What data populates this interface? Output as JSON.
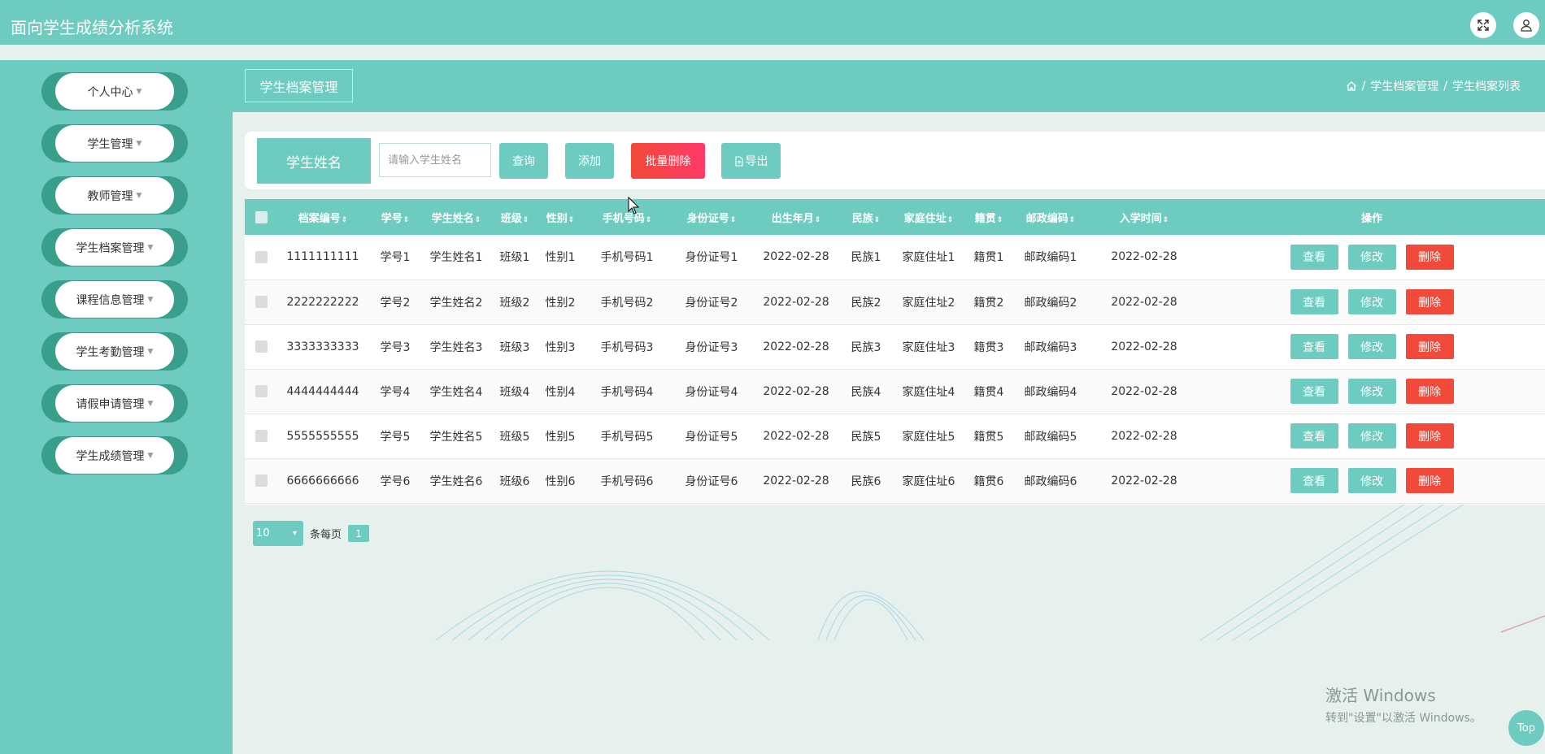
{
  "app": {
    "title": "面向学生成绩分析系统"
  },
  "header": {
    "fullscreen_icon": "expand-icon",
    "user_icon": "user-icon"
  },
  "sidebar": {
    "items": [
      {
        "label": "个人中心"
      },
      {
        "label": "学生管理"
      },
      {
        "label": "教师管理"
      },
      {
        "label": "学生档案管理"
      },
      {
        "label": "课程信息管理"
      },
      {
        "label": "学生考勤管理"
      },
      {
        "label": "请假申请管理"
      },
      {
        "label": "学生成绩管理"
      }
    ]
  },
  "page": {
    "tab_label": "学生档案管理",
    "breadcrumb": {
      "separator": "/",
      "level1": "学生档案管理",
      "level2": "学生档案列表"
    }
  },
  "search": {
    "label": "学生姓名",
    "placeholder": "请输入学生姓名",
    "value": "",
    "query_label": "查询",
    "add_label": "添加",
    "batch_delete_label": "批量删除",
    "export_label": "导出"
  },
  "table": {
    "columns": [
      "档案编号",
      "学号",
      "学生姓名",
      "班级",
      "性别",
      "手机号码",
      "身份证号",
      "出生年月",
      "民族",
      "家庭住址",
      "籍贯",
      "邮政编码",
      "入学时间",
      "操作"
    ],
    "rows": [
      [
        "1111111111",
        "学号1",
        "学生姓名1",
        "班级1",
        "性别1",
        "手机号码1",
        "身份证号1",
        "2022-02-28",
        "民族1",
        "家庭住址1",
        "籍贯1",
        "邮政编码1",
        "2022-02-28"
      ],
      [
        "2222222222",
        "学号2",
        "学生姓名2",
        "班级2",
        "性别2",
        "手机号码2",
        "身份证号2",
        "2022-02-28",
        "民族2",
        "家庭住址2",
        "籍贯2",
        "邮政编码2",
        "2022-02-28"
      ],
      [
        "3333333333",
        "学号3",
        "学生姓名3",
        "班级3",
        "性别3",
        "手机号码3",
        "身份证号3",
        "2022-02-28",
        "民族3",
        "家庭住址3",
        "籍贯3",
        "邮政编码3",
        "2022-02-28"
      ],
      [
        "4444444444",
        "学号4",
        "学生姓名4",
        "班级4",
        "性别4",
        "手机号码4",
        "身份证号4",
        "2022-02-28",
        "民族4",
        "家庭住址4",
        "籍贯4",
        "邮政编码4",
        "2022-02-28"
      ],
      [
        "5555555555",
        "学号5",
        "学生姓名5",
        "班级5",
        "性别5",
        "手机号码5",
        "身份证号5",
        "2022-02-28",
        "民族5",
        "家庭住址5",
        "籍贯5",
        "邮政编码5",
        "2022-02-28"
      ],
      [
        "6666666666",
        "学号6",
        "学生姓名6",
        "班级6",
        "性别6",
        "手机号码6",
        "身份证号6",
        "2022-02-28",
        "民族6",
        "家庭住址6",
        "籍贯6",
        "邮政编码6",
        "2022-02-28"
      ]
    ],
    "actions": {
      "view": "查看",
      "edit": "修改",
      "delete": "删除"
    }
  },
  "pagination": {
    "page_size": "10",
    "per_page_label": "条每页",
    "current_page": "1"
  },
  "os_watermark": {
    "line1": "激活 Windows",
    "line2": "转到\"设置\"以激活 Windows。"
  },
  "back_to_top": "Top",
  "colors": {
    "primary": "#6ecbbf",
    "danger": "#f24a3a",
    "sidebar_dark": "#3a9e8c",
    "background": "#e6f0ed"
  }
}
